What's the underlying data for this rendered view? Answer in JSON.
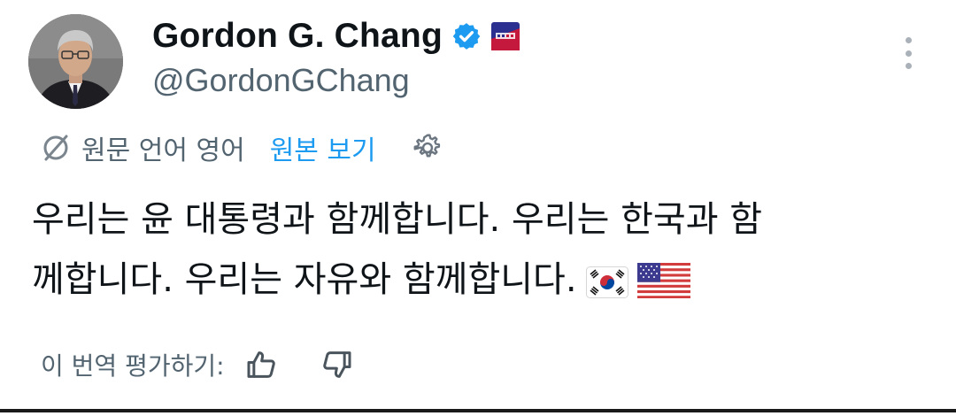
{
  "user": {
    "display_name": "Gordon G. Chang",
    "handle": "@GordonGChang",
    "verified_color": "#1d9bf0",
    "affiliation_badge": "cpac-logo"
  },
  "translation": {
    "source_label": "원문 언어 영어",
    "show_original": "원본 보기",
    "icon": "translate-icon",
    "settings_icon": "gear-icon"
  },
  "tweet": {
    "lines": [
      "우리는 윤 대통령과 함께합니다. 우리는 한국과 함",
      "께합니다. 우리는 자유와 함께합니다."
    ],
    "emoji": [
      "south-korea-flag",
      "united-states-flag"
    ]
  },
  "rating": {
    "label": "이 번역 평가하기:",
    "up_icon": "thumbs-up-icon",
    "down_icon": "thumbs-down-icon"
  },
  "colors": {
    "text": "#0f1419",
    "secondary": "#536471",
    "accent": "#1d9bf0"
  }
}
